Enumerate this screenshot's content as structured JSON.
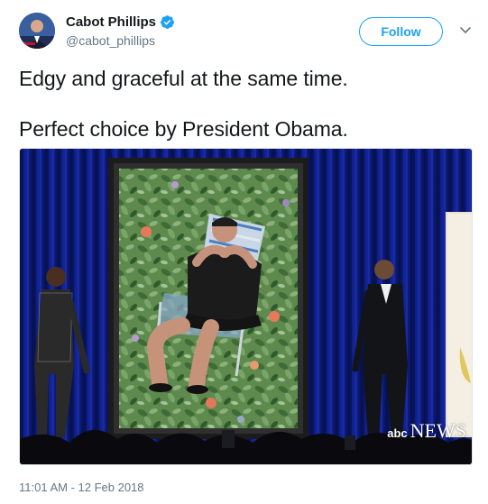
{
  "author": {
    "display_name": "Cabot Phillips",
    "handle": "@cabot_phillips",
    "verified": true,
    "avatar_icon": "avatar-photo"
  },
  "actions": {
    "follow_label": "Follow",
    "menu_icon": "chevron-down-icon"
  },
  "tweet": {
    "line1": "Edgy and graceful at the same time.",
    "line2": "Perfect choice by President Obama."
  },
  "media": {
    "watermark_small": "abc",
    "watermark_large": "NEWS"
  },
  "timestamp": "11:01 AM - 12 Feb 2018",
  "colors": {
    "accent": "#1da1f2",
    "text": "#14171a",
    "secondary": "#657786",
    "curtain": "#0b1566"
  }
}
